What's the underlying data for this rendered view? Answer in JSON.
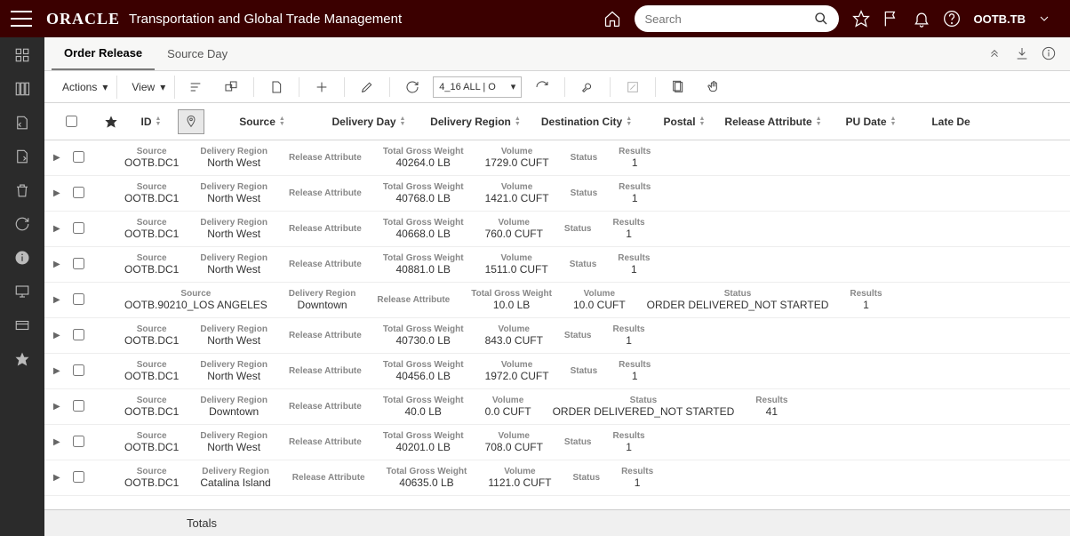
{
  "header": {
    "logo": "ORACLE",
    "app_title": "Transportation and Global Trade Management",
    "search_placeholder": "Search",
    "user": "OOTB.TB"
  },
  "tabs": {
    "active": "Order Release",
    "other": "Source Day"
  },
  "toolbar": {
    "actions": "Actions",
    "view": "View",
    "saved_search": "4_16 ALL | O"
  },
  "columns": {
    "id": "ID",
    "source": "Source",
    "delivery_day": "Delivery Day",
    "delivery_region": "Delivery Region",
    "destination_city": "Destination City",
    "postal": "Postal",
    "release_attribute": "Release Attribute",
    "pu_date": "PU Date",
    "late_delivery": "Late De"
  },
  "labels": {
    "source": "Source",
    "delivery_region": "Delivery Region",
    "release_attribute": "Release Attribute",
    "total_gross_weight": "Total Gross Weight",
    "volume": "Volume",
    "status": "Status",
    "results": "Results"
  },
  "rows": [
    {
      "source": "OOTB.DC1",
      "delivery_region": "North West",
      "release_attribute": "",
      "total_gross_weight": "40264.0 LB",
      "volume": "1729.0 CUFT",
      "status": "",
      "results": "1"
    },
    {
      "source": "OOTB.DC1",
      "delivery_region": "North West",
      "release_attribute": "",
      "total_gross_weight": "40768.0 LB",
      "volume": "1421.0 CUFT",
      "status": "",
      "results": "1"
    },
    {
      "source": "OOTB.DC1",
      "delivery_region": "North West",
      "release_attribute": "",
      "total_gross_weight": "40668.0 LB",
      "volume": "760.0 CUFT",
      "status": "",
      "results": "1"
    },
    {
      "source": "OOTB.DC1",
      "delivery_region": "North West",
      "release_attribute": "",
      "total_gross_weight": "40881.0 LB",
      "volume": "1511.0 CUFT",
      "status": "",
      "results": "1"
    },
    {
      "source": "OOTB.90210_LOS ANGELES",
      "delivery_region": "Downtown",
      "release_attribute": "",
      "total_gross_weight": "10.0 LB",
      "volume": "10.0 CUFT",
      "status": "ORDER DELIVERED_NOT STARTED",
      "results": "1"
    },
    {
      "source": "OOTB.DC1",
      "delivery_region": "North West",
      "release_attribute": "",
      "total_gross_weight": "40730.0 LB",
      "volume": "843.0 CUFT",
      "status": "",
      "results": "1"
    },
    {
      "source": "OOTB.DC1",
      "delivery_region": "North West",
      "release_attribute": "",
      "total_gross_weight": "40456.0 LB",
      "volume": "1972.0 CUFT",
      "status": "",
      "results": "1"
    },
    {
      "source": "OOTB.DC1",
      "delivery_region": "Downtown",
      "release_attribute": "",
      "total_gross_weight": "40.0 LB",
      "volume": "0.0 CUFT",
      "status": "ORDER DELIVERED_NOT STARTED",
      "results": "41"
    },
    {
      "source": "OOTB.DC1",
      "delivery_region": "North West",
      "release_attribute": "",
      "total_gross_weight": "40201.0 LB",
      "volume": "708.0 CUFT",
      "status": "",
      "results": "1"
    },
    {
      "source": "OOTB.DC1",
      "delivery_region": "Catalina Island",
      "release_attribute": "",
      "total_gross_weight": "40635.0 LB",
      "volume": "1121.0 CUFT",
      "status": "",
      "results": "1"
    }
  ],
  "totals_label": "Totals"
}
